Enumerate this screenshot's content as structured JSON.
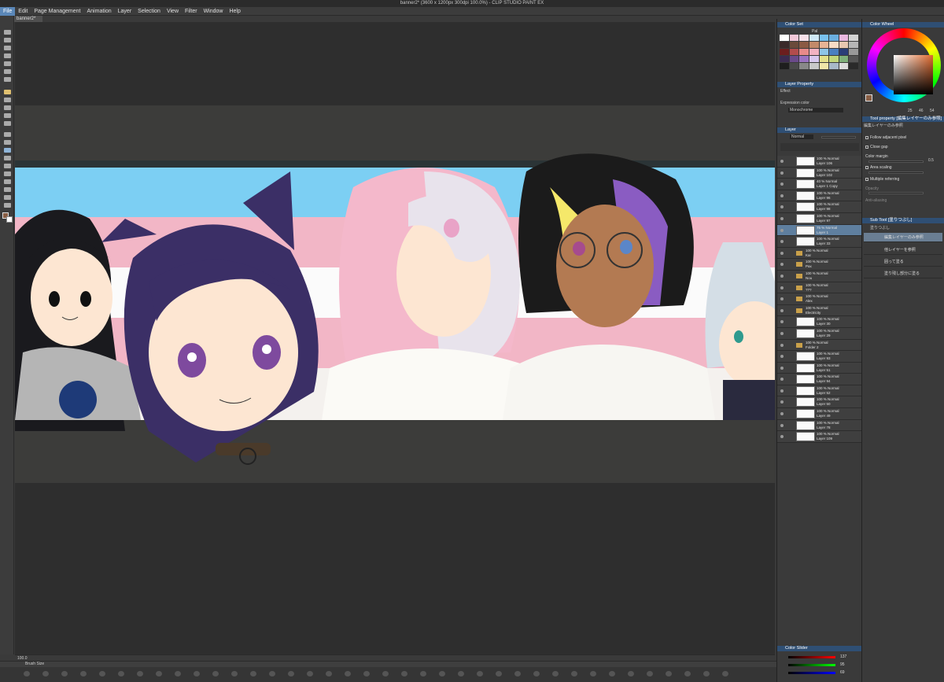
{
  "window": {
    "title": "banner2* (3600 x 1200px 300dpi 100.0%)  - CLIP STUDIO PAINT EX"
  },
  "menu": [
    "File",
    "Edit",
    "Page Management",
    "Animation",
    "Layer",
    "Selection",
    "View",
    "Filter",
    "Window",
    "Help"
  ],
  "doc_tab": "banner2*",
  "status": {
    "zoom": "100.0"
  },
  "timeline": {
    "title": "Brush Size"
  },
  "color_set": {
    "title": "Color Set",
    "palette_name": "Pal",
    "swatches": [
      "#ffffff",
      "#f2c7d8",
      "#f8e1ea",
      "#cfe8f7",
      "#79c1ee",
      "#6aaee0",
      "#e9b7e0",
      "#d4d4d4",
      "#3a2a2a",
      "#6b4a3a",
      "#8b5a44",
      "#c28a6a",
      "#e7b495",
      "#f7dcc5",
      "#e8c7b0",
      "#b6b6b6",
      "#6b1e1e",
      "#b24c4c",
      "#e88a8a",
      "#f2b3c2",
      "#8ec5e8",
      "#4a7fc0",
      "#2a3e78",
      "#999999",
      "#3b2b4f",
      "#6a4a8a",
      "#9a72c2",
      "#d8c9ef",
      "#e3e08a",
      "#c2d67a",
      "#7fb07a",
      "#555555",
      "#1e1e1e",
      "#4a4a4a",
      "#888888",
      "#c8c8c8",
      "#f0e6a8",
      "#a8b8c8",
      "#dcdcdc",
      "#2a2a2a"
    ]
  },
  "layer_property": {
    "title": "Layer Property",
    "effect": "Effect",
    "expression_label": "Expression color",
    "expression_value": "Monochrome"
  },
  "layer_panel": {
    "title": "Layer",
    "blend": "Normal",
    "layers": [
      {
        "name": "100 % Normal",
        "sub": "Layer 106",
        "type": "layer"
      },
      {
        "name": "100 % Normal",
        "sub": "Layer 102",
        "type": "layer"
      },
      {
        "name": "40 % Normal",
        "sub": "Layer 1 Copy",
        "type": "layer"
      },
      {
        "name": "100 % Normal",
        "sub": "Layer 96",
        "type": "layer"
      },
      {
        "name": "100 % Normal",
        "sub": "Layer 98",
        "type": "layer"
      },
      {
        "name": "100 % Normal",
        "sub": "Layer 97",
        "type": "layer"
      },
      {
        "name": "75 % Normal",
        "sub": "Layer 1",
        "type": "layer",
        "selected": true
      },
      {
        "name": "100 % Normal",
        "sub": "Layer 33",
        "type": "layer"
      },
      {
        "name": "100 % Normal",
        "sub": "Kar",
        "type": "folder"
      },
      {
        "name": "100 % Normal",
        "sub": "Pax",
        "type": "folder"
      },
      {
        "name": "100 % Normal",
        "sub": "Nou",
        "type": "folder"
      },
      {
        "name": "100 % Normal",
        "sub": "???",
        "type": "folder"
      },
      {
        "name": "100 % Normal",
        "sub": "Alex",
        "type": "folder"
      },
      {
        "name": "100 % Normal",
        "sub": "Electricity",
        "type": "folder"
      },
      {
        "name": "100 % Normal",
        "sub": "Layer 30",
        "type": "layer"
      },
      {
        "name": "100 % Normal",
        "sub": "Layer 29",
        "type": "layer"
      },
      {
        "name": "100 % Normal",
        "sub": "Folder 2",
        "type": "folder"
      },
      {
        "name": "100 % Normal",
        "sub": "Layer 93",
        "type": "layer"
      },
      {
        "name": "100 % Normal",
        "sub": "Layer 51",
        "type": "layer"
      },
      {
        "name": "100 % Normal",
        "sub": "Layer 94",
        "type": "layer"
      },
      {
        "name": "100 % Normal",
        "sub": "Layer 52",
        "type": "layer"
      },
      {
        "name": "100 % Normal",
        "sub": "Layer 50",
        "type": "layer"
      },
      {
        "name": "100 % Normal",
        "sub": "Layer 49",
        "type": "layer"
      },
      {
        "name": "100 % Normal",
        "sub": "Layer 78",
        "type": "layer"
      },
      {
        "name": "100 % Normal",
        "sub": "Layer 109",
        "type": "layer"
      }
    ]
  },
  "color_wheel": {
    "title": "Color Wheel",
    "h": "25",
    "s": "46",
    "v": "54"
  },
  "tool_property": {
    "title": "Tool property [編集レイヤーのみ参照]",
    "subtitle": "編集レイヤーのみ参照",
    "follow_adjacent": "Follow adjacent pixel",
    "close_gap": "Close gap",
    "color_margin": "Color margin",
    "color_margin_value": "0.5",
    "area_scaling": "Area scaling",
    "multiple_referring": "Multiple referring",
    "opacity": "Opacity",
    "anti_aliasing": "Anti-aliasing"
  },
  "sub_tool": {
    "title": "Sub Tool [塗りつぶし]",
    "group": "塗りつぶし",
    "items": [
      "編集レイヤーのみ参照",
      "他レイヤーを参照",
      "囲って塗る",
      "塗り残し部分に塗る"
    ]
  },
  "color_slider": {
    "title": "Color Slider",
    "r": "137",
    "g": "95",
    "b": "69"
  }
}
